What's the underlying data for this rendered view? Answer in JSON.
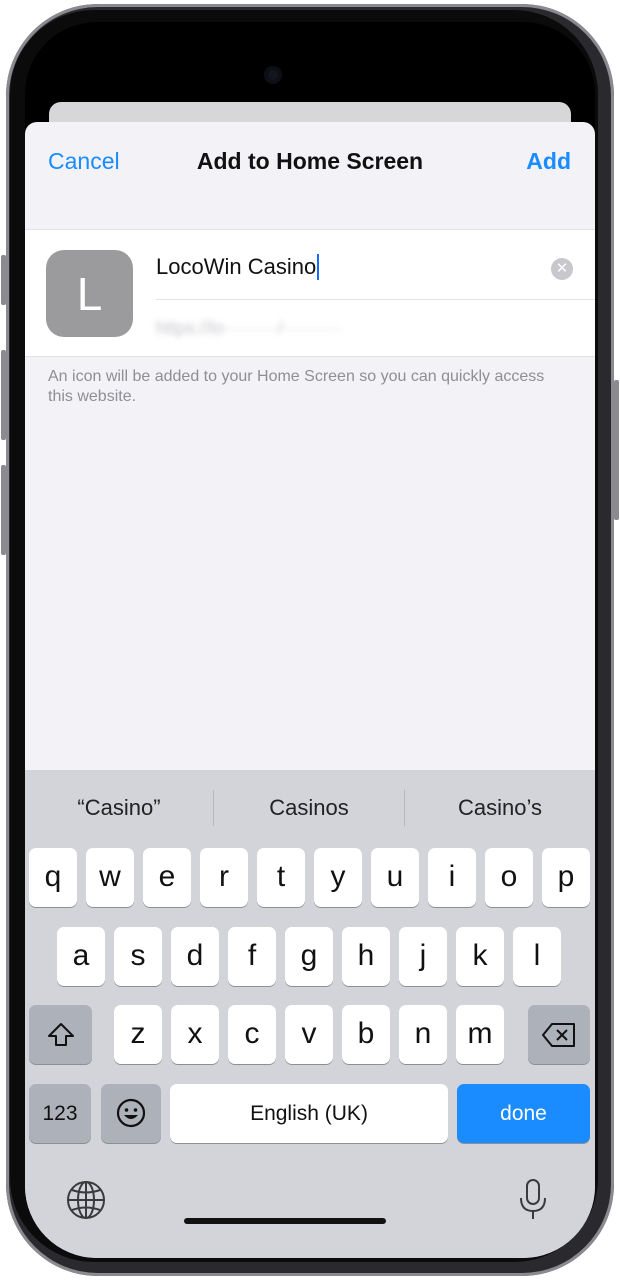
{
  "nav": {
    "cancel": "Cancel",
    "title": "Add to Home Screen",
    "add": "Add"
  },
  "app_icon_letter": "L",
  "name_input": {
    "value": "LocoWin Casino"
  },
  "hint": "An icon will be added to your Home Screen so you can quickly access this website.",
  "suggestions": [
    "“Casino”",
    "Casinos",
    "Casino’s"
  ],
  "keyboard": {
    "row1": [
      "q",
      "w",
      "e",
      "r",
      "t",
      "y",
      "u",
      "i",
      "o",
      "p"
    ],
    "row2": [
      "a",
      "s",
      "d",
      "f",
      "g",
      "h",
      "j",
      "k",
      "l"
    ],
    "row3": [
      "z",
      "x",
      "c",
      "v",
      "b",
      "n",
      "m"
    ],
    "numbers_label": "123",
    "space_label": "English (UK)",
    "done_label": "done"
  },
  "colors": {
    "accent": "#1a8cff",
    "keyboard_bg": "#d2d4da",
    "icon_bg": "#9b9b9d"
  },
  "icons": {
    "emoji": "emoji-icon",
    "shift": "shift-icon",
    "delete": "delete-icon",
    "globe": "globe-icon",
    "mic": "microphone-icon",
    "clear": "clear-text-icon"
  }
}
